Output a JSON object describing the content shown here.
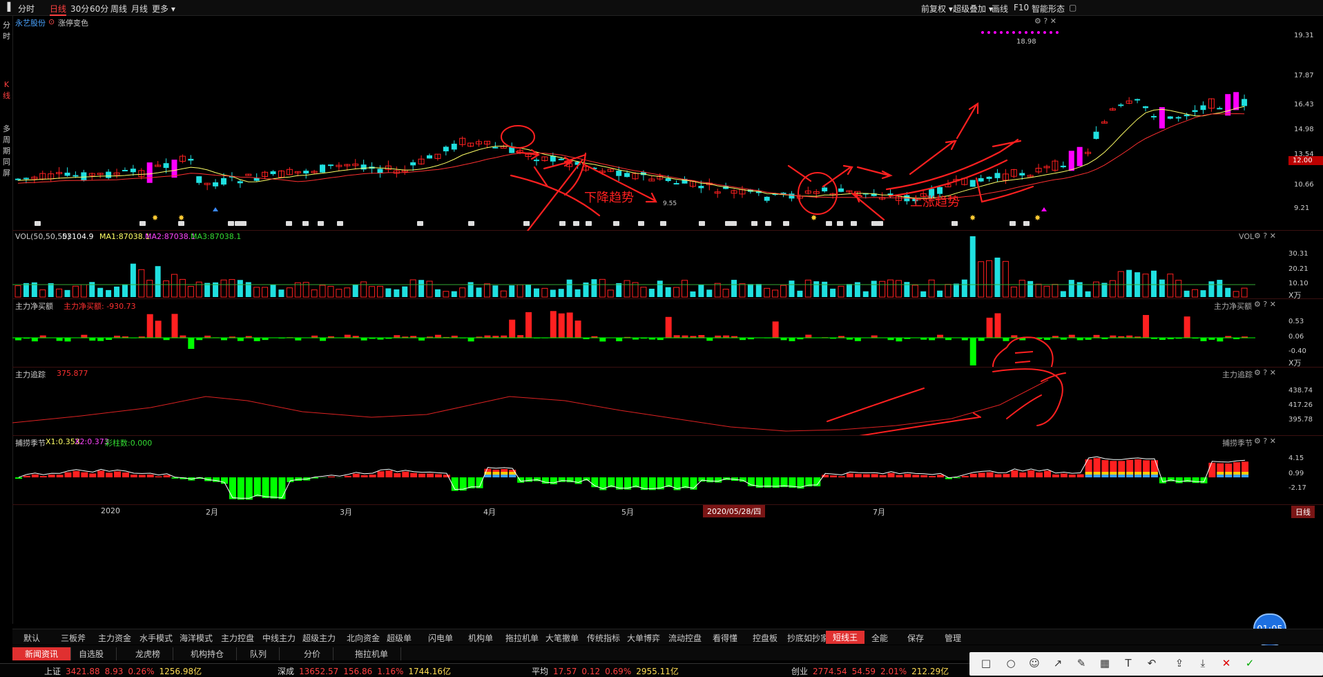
{
  "topbar": {
    "period_tabs": [
      "分时",
      "日线",
      "30分",
      "60分",
      "周线",
      "月线",
      "更多 ▾"
    ],
    "active_tab": "日线",
    "right_items": [
      "前复权 ▾",
      "超级叠加 ▾",
      "画线",
      "F10",
      "智能形态"
    ]
  },
  "left_nav": [
    "分时",
    "K线",
    "多周期同屏"
  ],
  "kline": {
    "stock_name": "永艺股份",
    "option": "涨停变色",
    "price_axis": [
      "19.31",
      "17.87",
      "16.43",
      "14.98",
      "13.54",
      "12.00",
      "10.66",
      "9.21"
    ],
    "current_price": "12.00",
    "high_label": "18.98",
    "low_label": "9.55",
    "annotations": {
      "down": "下降趋势",
      "up": "上涨趋势"
    }
  },
  "vol": {
    "label": "VOL(50,50,50)",
    "value": "53104.9",
    "ma1": "MA1:87038.1",
    "ma2": "MA2:87038.1",
    "ma3": "MA3:87038.1",
    "title": "VOL",
    "axis": [
      "30.31",
      "20.21",
      "10.10"
    ],
    "unit": "X万"
  },
  "netbuy": {
    "label": "主力净买额",
    "value_label": "主力净买额: -930.73",
    "title": "主力净买额",
    "axis": [
      "0.53",
      "0.06",
      "-0.40"
    ],
    "unit": "X万"
  },
  "track": {
    "label": "主力追踪",
    "value": "375.877",
    "title": "主力追踪",
    "axis": [
      "438.74",
      "417.26",
      "395.78"
    ]
  },
  "season": {
    "label": "捕捞季节",
    "x1": "X1:0.353",
    "x2": "X2:0.373",
    "bars": "彩柱数:0.000",
    "title": "捕捞季节",
    "axis": [
      "4.15",
      "0.99",
      "-2.17"
    ]
  },
  "time_axis": {
    "labels": [
      "2020",
      "2月",
      "3月",
      "4月",
      "5月",
      "7月"
    ],
    "cursor_date": "2020/05/28/四",
    "period": "日线",
    "clock": "01:05"
  },
  "indicator_tabs": [
    "默认",
    "三板斧",
    "主力资金",
    "水手模式",
    "海洋模式",
    "主力控盘",
    "中线主力",
    "超级主力",
    "北向资金",
    "超级单",
    "闪电单",
    "机构单",
    "拖拉机单",
    "大笔撤单",
    "传统指标",
    "大单博弈",
    "流动控盘",
    "看得懂",
    "控盘板",
    "抄底如抄家",
    "短线王",
    "全能",
    "保存",
    "管理"
  ],
  "active_indicator": "短线王",
  "news_tabs": [
    "新闻资讯",
    "自选股",
    "龙虎榜",
    "机构持仓",
    "队列",
    "分价",
    "拖拉机单"
  ],
  "active_news": "新闻资讯",
  "status": [
    {
      "name": "上证",
      "price": "3421.88",
      "chg": "8.93",
      "pct": "0.26%",
      "amt": "1256.98亿"
    },
    {
      "name": "深成",
      "price": "13652.57",
      "chg": "156.86",
      "pct": "1.16%",
      "amt": "1744.16亿"
    },
    {
      "name": "平均",
      "price": "17.57",
      "chg": "0.12",
      "pct": "0.69%",
      "amt": "2955.11亿"
    },
    {
      "name": "创业",
      "price": "2774.54",
      "chg": "54.59",
      "pct": "2.01%",
      "amt": "212.29亿"
    }
  ],
  "colors": {
    "up": "#ff2020",
    "down": "#20e0e0",
    "limit": "#ff00ff",
    "ma1": "#ffff66",
    "ma2": "#ff3030",
    "annot": "#ff2020",
    "green": "#00ff00"
  }
}
